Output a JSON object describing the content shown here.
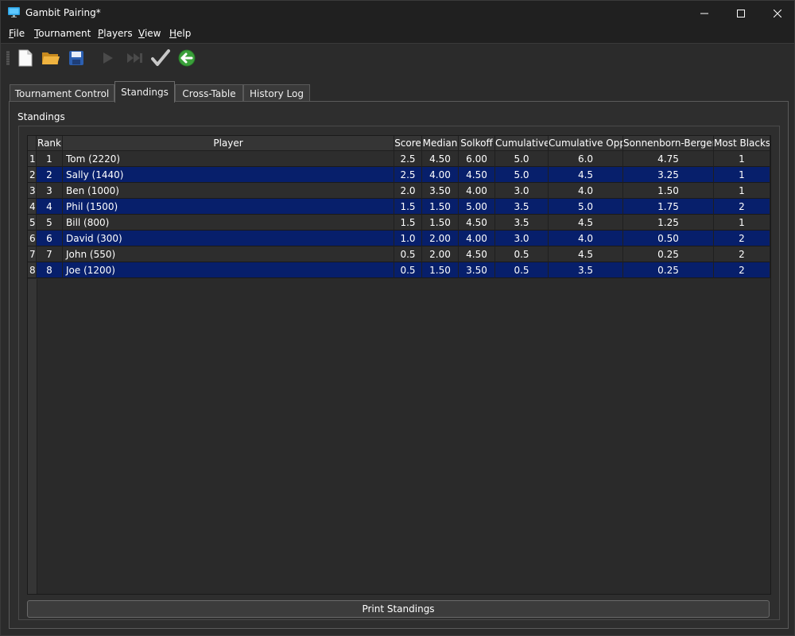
{
  "window": {
    "title": "Gambit Pairing*"
  },
  "menu": [
    {
      "label": "File",
      "mnemonic": "F",
      "rest": "ile"
    },
    {
      "label": "Tournament",
      "mnemonic": "T",
      "rest": "ournament"
    },
    {
      "label": "Players",
      "mnemonic": "P",
      "rest": "layers"
    },
    {
      "label": "View",
      "mnemonic": "V",
      "rest": "iew"
    },
    {
      "label": "Help",
      "mnemonic": "H",
      "rest": "elp"
    }
  ],
  "toolbar": {
    "icons": [
      "new-file-icon",
      "open-folder-icon",
      "save-icon",
      "play-icon",
      "fast-forward-icon",
      "checkmark-icon",
      "back-arrow-icon"
    ]
  },
  "tabs": [
    "Tournament Control",
    "Standings",
    "Cross-Table",
    "History Log"
  ],
  "active_tab": "Standings",
  "standings": {
    "group_label": "Standings",
    "columns": [
      "Rank",
      "Player",
      "Score",
      "Median",
      "Solkoff",
      "Cumulative",
      "Cumulative Opp",
      "Sonnenborn-Berger",
      "Most Blacks"
    ],
    "rows": [
      [
        "1",
        "1",
        "Tom (2220)",
        "2.5",
        "4.50",
        "6.00",
        "5.0",
        "6.0",
        "4.75",
        "1"
      ],
      [
        "2",
        "2",
        "Sally (1440)",
        "2.5",
        "4.00",
        "4.50",
        "5.0",
        "4.5",
        "3.25",
        "1"
      ],
      [
        "3",
        "3",
        "Ben (1000)",
        "2.0",
        "3.50",
        "4.00",
        "3.0",
        "4.0",
        "1.50",
        "1"
      ],
      [
        "4",
        "4",
        "Phil (1500)",
        "1.5",
        "1.50",
        "5.00",
        "3.5",
        "5.0",
        "1.75",
        "2"
      ],
      [
        "5",
        "5",
        "Bill (800)",
        "1.5",
        "1.50",
        "4.50",
        "3.5",
        "4.5",
        "1.25",
        "1"
      ],
      [
        "6",
        "6",
        "David (300)",
        "1.0",
        "2.00",
        "4.00",
        "3.0",
        "4.0",
        "0.50",
        "2"
      ],
      [
        "7",
        "7",
        "John (550)",
        "0.5",
        "2.00",
        "4.50",
        "0.5",
        "4.5",
        "0.25",
        "2"
      ],
      [
        "8",
        "8",
        "Joe (1200)",
        "0.5",
        "1.50",
        "3.50",
        "0.5",
        "3.5",
        "0.25",
        "2"
      ]
    ],
    "print_button": "Print Standings"
  },
  "colors": {
    "highlight_row": "#071f6b",
    "background": "#2b2b2b"
  }
}
